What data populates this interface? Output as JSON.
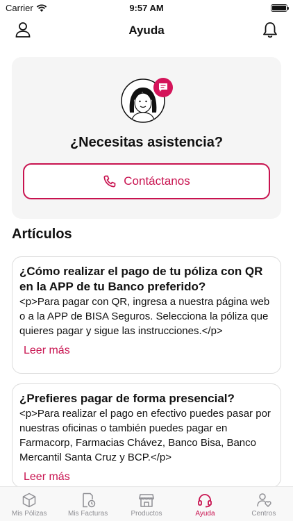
{
  "status_bar": {
    "carrier": "Carrier",
    "time": "9:57 AM"
  },
  "nav": {
    "title": "Ayuda",
    "user_icon": "user-icon",
    "bell_icon": "bell-icon"
  },
  "assist": {
    "title": "¿Necesitas asistencia?",
    "contact_label": "Contáctanos",
    "accent": "#c8124f"
  },
  "articles_section": {
    "title": "Artículos"
  },
  "articles": [
    {
      "title": "¿Cómo realizar el pago de tu póliza con QR en la APP de tu Banco preferido?",
      "body": "<p>Para pagar con QR, ingresa a nuestra página web o a la APP de BISA Seguros. Selecciona la póliza que quieres pagar y sigue las instrucciones.</p>",
      "link": "Leer más"
    },
    {
      "title": "¿Prefieres pagar de forma presencial?",
      "body": "<p>Para realizar el pago en efectivo puedes pasar por nuestras oficinas o también puedes pagar en Farmacorp, Farmacias Chávez, Banco Bisa, Banco Mercantil Santa Cruz y BCP.</p>",
      "link": "Leer más"
    }
  ],
  "tabs": [
    {
      "label": "Mis Pólizas",
      "icon": "box-icon",
      "active": false
    },
    {
      "label": "Mis Facturas",
      "icon": "invoice-clock-icon",
      "active": false
    },
    {
      "label": "Productos",
      "icon": "store-icon",
      "active": false
    },
    {
      "label": "Ayuda",
      "icon": "headset-icon",
      "active": true
    },
    {
      "label": "Centros",
      "icon": "user-heart-icon",
      "active": false
    }
  ]
}
